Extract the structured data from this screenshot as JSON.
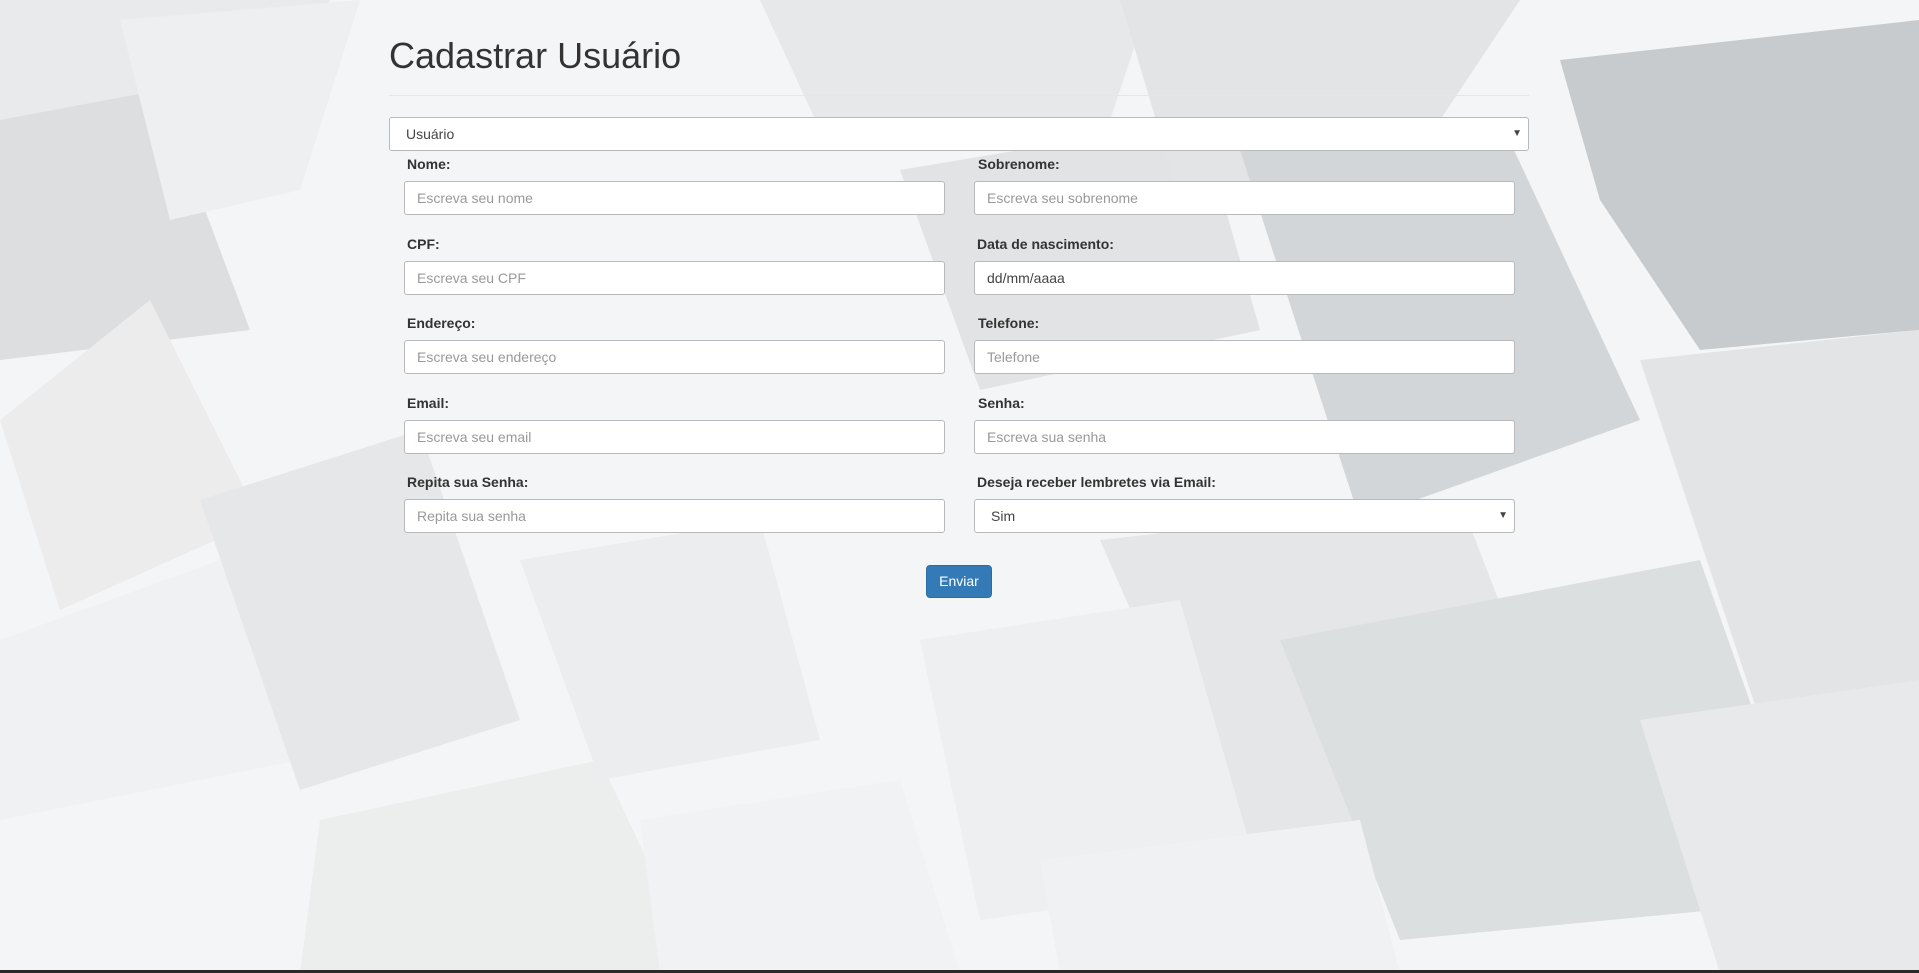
{
  "page": {
    "title": "Cadastrar Usuário"
  },
  "user_type_select": {
    "value": "Usuário"
  },
  "fields": {
    "nome": {
      "label": "Nome:",
      "placeholder": "Escreva seu nome"
    },
    "sobrenome": {
      "label": "Sobrenome:",
      "placeholder": "Escreva seu sobrenome"
    },
    "cpf": {
      "label": "CPF:",
      "placeholder": "Escreva seu CPF"
    },
    "nascimento": {
      "label": "Data de nascimento:",
      "value": "dd/mm/aaaa"
    },
    "endereco": {
      "label": "Endereço:",
      "placeholder": "Escreva seu endereço"
    },
    "telefone": {
      "label": "Telefone:",
      "placeholder": "Telefone"
    },
    "email": {
      "label": "Email:",
      "placeholder": "Escreva seu email"
    },
    "senha": {
      "label": "Senha:",
      "placeholder": "Escreva sua senha"
    },
    "repita_senha": {
      "label": "Repita sua Senha:",
      "placeholder": "Repita sua senha"
    },
    "lembretes": {
      "label": "Deseja receber lembretes via Email:",
      "value": "Sim"
    }
  },
  "submit": {
    "label": "Enviar"
  },
  "icons": {
    "select_caret": "chevron-down-icon"
  },
  "colors": {
    "primary": "#337ab7",
    "background": "#f2f3f4"
  }
}
